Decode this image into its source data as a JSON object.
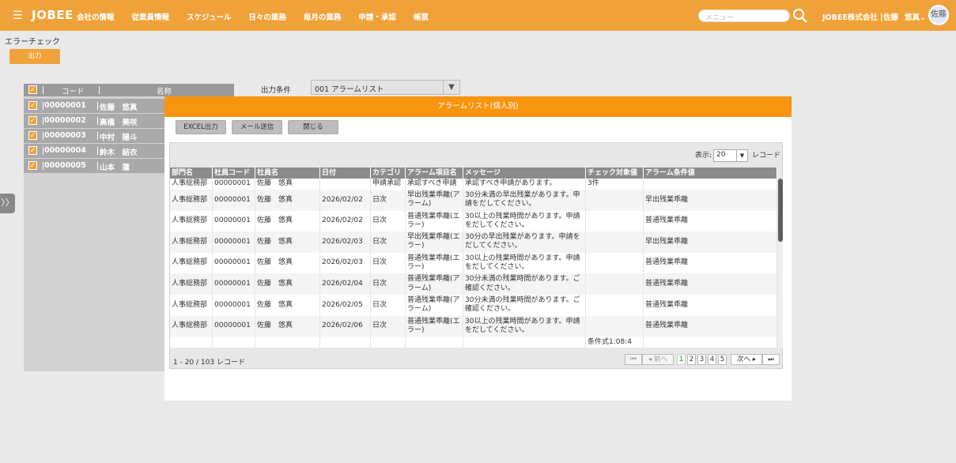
{
  "header": {
    "logo": "JOBEE",
    "menu_icon": "hamburger-icon",
    "nav": [
      "会社の情報",
      "従業員情報",
      "スケジュール",
      "日々の業務",
      "毎月の業務",
      "申請・承認",
      "帳票"
    ],
    "search_placeholder": "メニュー",
    "company": "JOBEE株式会社",
    "user_last": "佐藤",
    "user_first": "悠真",
    "avatar": "佐藤"
  },
  "page": {
    "title": "エラーチェック",
    "output_button": "出力"
  },
  "left_panel": {
    "col_code": "コード",
    "col_name": "名称",
    "rows": [
      {
        "code": "00000001",
        "name": "佐藤　悠真"
      },
      {
        "code": "00000002",
        "name": "高橋　美咲"
      },
      {
        "code": "00000003",
        "name": "中村　陽斗"
      },
      {
        "code": "00000004",
        "name": "鈴木　結衣"
      },
      {
        "code": "00000005",
        "name": "山本　蓮"
      }
    ]
  },
  "condition": {
    "label": "出力条件",
    "value": "001  アラームリスト"
  },
  "modal": {
    "title": "アラームリスト(個人別)",
    "excel_button": "EXCEL出力",
    "mail_button": "メール送信",
    "close_button": "閉じる",
    "display_label": "表示:",
    "display_value": "20",
    "record_label": "レコード",
    "columns": [
      "部門名",
      "社員コード",
      "社員名",
      "日付",
      "カテゴリ",
      "アラーム項目名",
      "メッセージ",
      "チェック対象値",
      "アラーム条件値"
    ],
    "rows": [
      [
        "人事総務部",
        "00000001",
        "佐藤　悠真",
        "",
        "申請承認",
        "承認すべき申請",
        "承認すべき申請があります。",
        "3件",
        ""
      ],
      [
        "人事総務部",
        "00000001",
        "佐藤　悠真",
        "2026/02/02",
        "日次",
        "早出残業乖離(アラーム)",
        "30分未満の早出残業があります。申請をだしてください。",
        "",
        "早出残業乖離"
      ],
      [
        "人事総務部",
        "00000001",
        "佐藤　悠真",
        "2026/02/02",
        "日次",
        "普通残業乖離(エラー)",
        "30以上の残業時間があります。申請をだしてください。",
        "",
        "普通残業乖離"
      ],
      [
        "人事総務部",
        "00000001",
        "佐藤　悠真",
        "2026/02/03",
        "日次",
        "早出残業乖離(エラー)",
        "30分の早出残業があります。申請をだしてください。",
        "",
        "早出残業乖離"
      ],
      [
        "人事総務部",
        "00000001",
        "佐藤　悠真",
        "2026/02/03",
        "日次",
        "普通残業乖離(エラー)",
        "30以上の残業時間があります。申請をだしてください。",
        "",
        "普通残業乖離"
      ],
      [
        "人事総務部",
        "00000001",
        "佐藤　悠真",
        "2026/02/04",
        "日次",
        "普通残業乖離(アラーム)",
        "30分未満の残業時間があります。ご確認ください。",
        "",
        "普通残業乖離"
      ],
      [
        "人事総務部",
        "00000001",
        "佐藤　悠真",
        "2026/02/05",
        "日次",
        "普通残業乖離(アラーム)",
        "30分未満の残業時間があります。ご確認ください。",
        "",
        "普通残業乖離"
      ],
      [
        "人事総務部",
        "00000001",
        "佐藤　悠真",
        "2026/02/06",
        "日次",
        "普通残業乖離(エラー)",
        "30以上の残業時間があります。申請をだしてください。",
        "",
        "普通残業乖離"
      ],
      [
        "",
        "",
        "",
        "",
        "",
        "",
        "",
        "条件式1:08:4",
        ""
      ]
    ],
    "record_summary": "1 - 20 / 103 レコード",
    "pager": {
      "first": "⏮",
      "prev": "◂ 前へ",
      "pages": [
        "1",
        "2",
        "3",
        "4",
        "5"
      ],
      "current": "1",
      "next": "次へ ▸",
      "last": "⏭"
    }
  }
}
